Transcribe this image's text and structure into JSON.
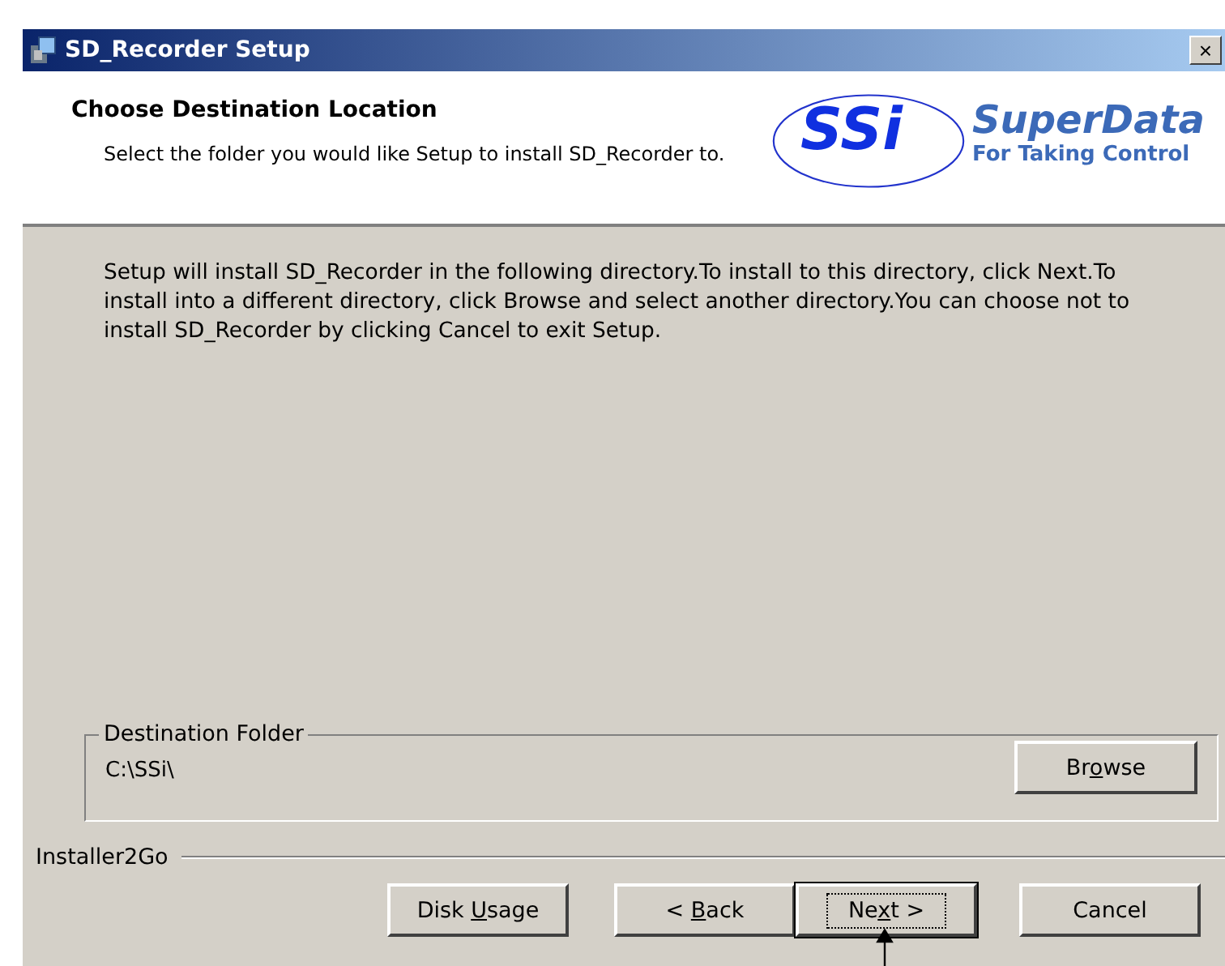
{
  "window": {
    "title": "SD_Recorder Setup",
    "close": "×"
  },
  "header": {
    "title": "Choose Destination Location",
    "subtitle": "Select the folder you would like Setup to install SD_Recorder to.",
    "logo": {
      "mark": "SSi",
      "name": "SuperData",
      "tagline": "For Taking Control"
    }
  },
  "body": {
    "text": "Setup will install SD_Recorder in the following directory.To install to this directory, click Next.To install into a different directory, click Browse and select another directory.You can choose not to install SD_Recorder by clicking Cancel to exit Setup."
  },
  "destination": {
    "legend": "Destination Folder",
    "path": "C:\\SSi\\",
    "browse": [
      "Br",
      "o",
      "wse"
    ]
  },
  "footer": {
    "brand": "Installer2Go"
  },
  "buttons": [
    {
      "parts": [
        "Disk ",
        "U",
        "sage"
      ],
      "default": false
    },
    {
      "parts": [
        "< ",
        "B",
        "ack"
      ],
      "default": false
    },
    {
      "parts": [
        "Ne",
        "x",
        "t >"
      ],
      "default": true
    },
    {
      "parts": [
        "Cancel"
      ],
      "default": false
    }
  ]
}
